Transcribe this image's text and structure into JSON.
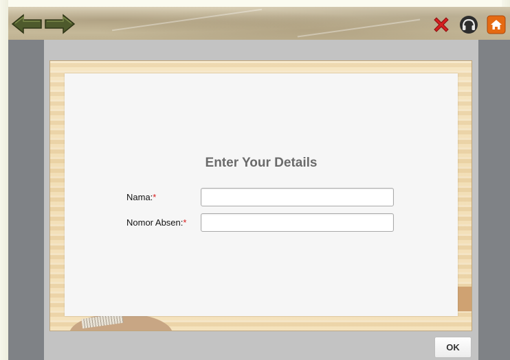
{
  "toolbar": {
    "back_icon": "back-arrow-icon",
    "forward_icon": "forward-arrow-icon",
    "close_icon": "close-icon",
    "audio_icon": "headphones-icon",
    "home_icon": "home-icon"
  },
  "form": {
    "title": "Enter Your Details",
    "required_mark": "*",
    "fields": [
      {
        "label": "Nama:",
        "value": "",
        "placeholder": ""
      },
      {
        "label": "Nomor Absen:",
        "value": "",
        "placeholder": ""
      }
    ],
    "ok_label": "OK"
  },
  "colors": {
    "arrow": "#4e5a2c",
    "close": "#d42020",
    "home": "#e56a12",
    "stage": "#7f8286",
    "required": "#d61a1a"
  }
}
